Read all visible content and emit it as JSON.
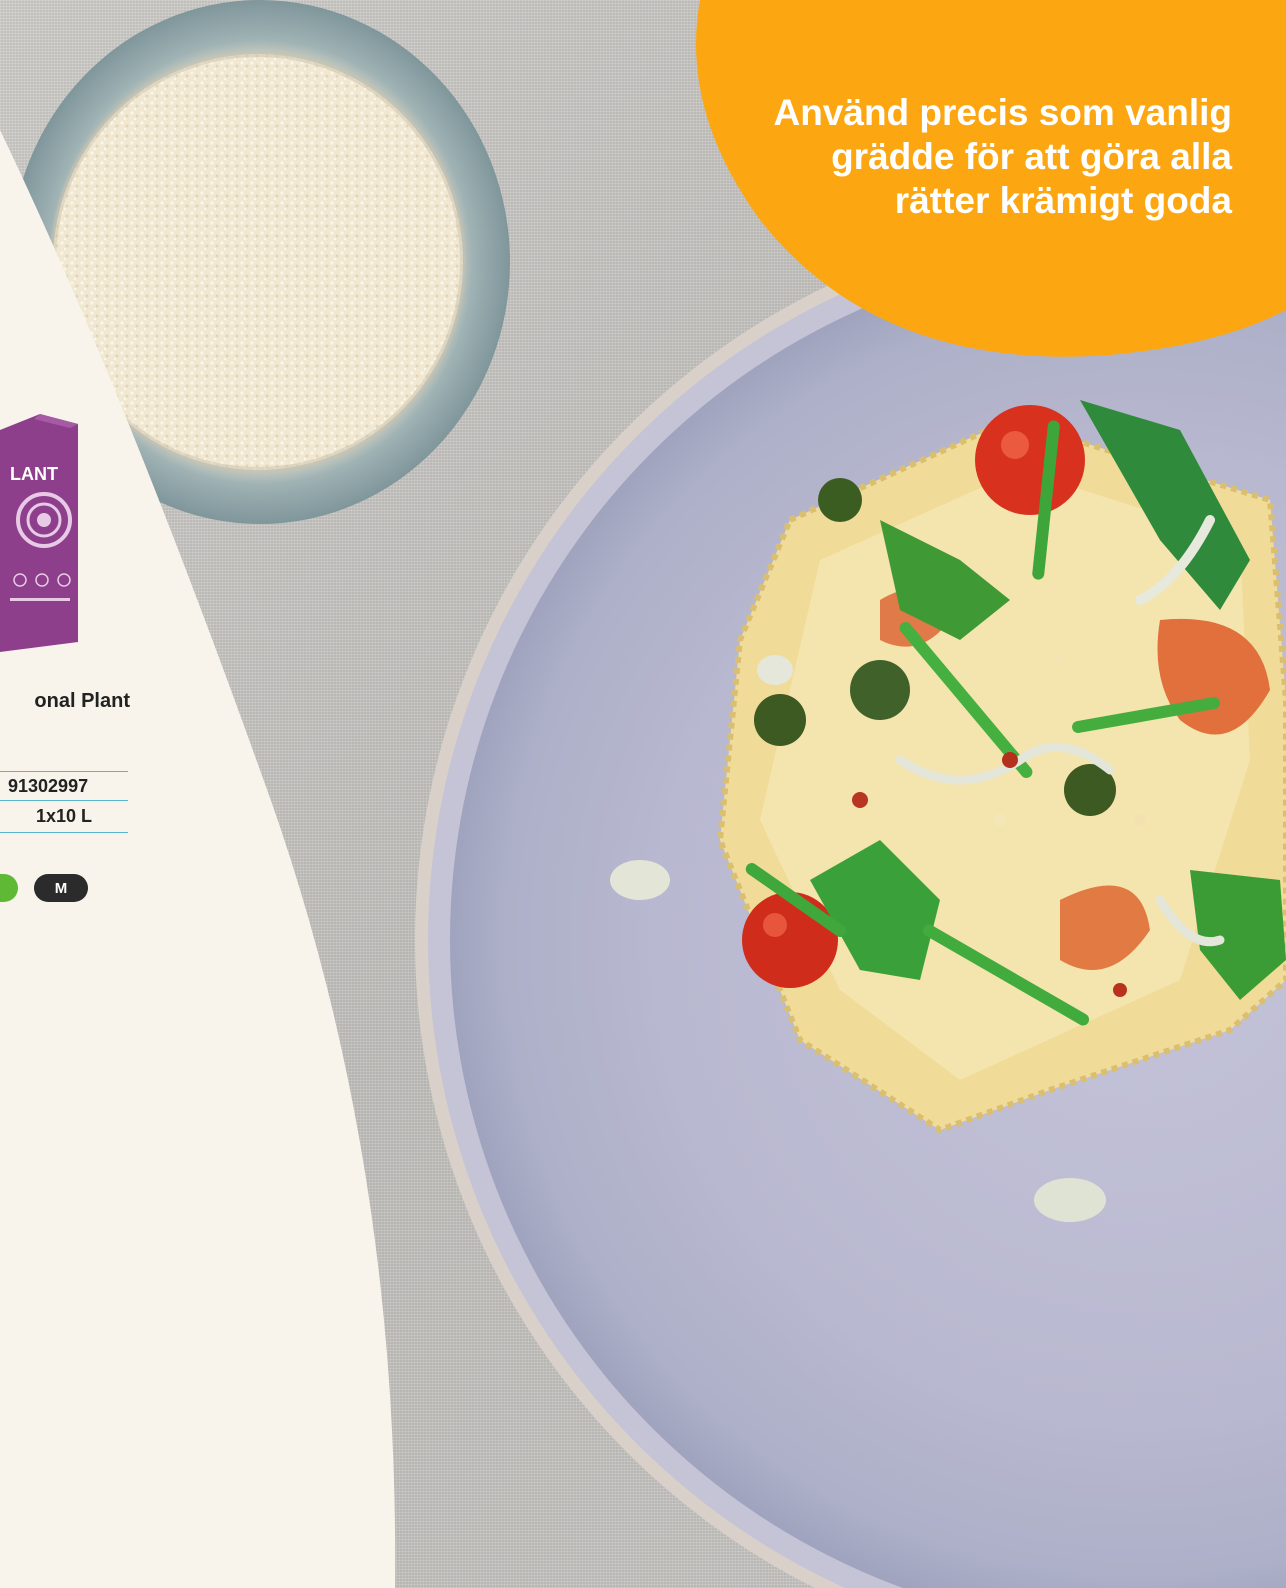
{
  "callout": {
    "lines": [
      "Använd precis som vanlig",
      "grädde för att göra alla",
      "rätter krämigt goda"
    ]
  },
  "product": {
    "name": "onal Plant",
    "box_text": "LANT",
    "specs": [
      {
        "value": "91302997"
      },
      {
        "value": "1x10 L"
      }
    ],
    "badges": [
      "M"
    ]
  },
  "colors": {
    "cream_panel": "#f8f4eb",
    "callout_orange": "#fca712",
    "spec_rule": "#58b7cf",
    "badge_green": "#5fb935",
    "badge_dark": "#2b2b2b",
    "box_purple": "#8e3f8c"
  }
}
